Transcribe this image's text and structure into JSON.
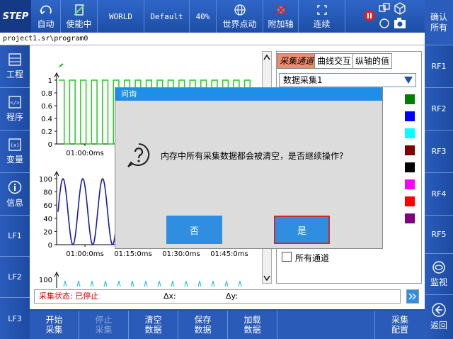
{
  "topbar": {
    "step": "STEP",
    "auto": "自动",
    "enable": "使能中",
    "world": "WORLD",
    "default": "Default",
    "speed": "40%",
    "world_jog": "世界点动",
    "aux_axis": "附加轴",
    "continuous": "连续"
  },
  "path": "project1.sr\\program0",
  "left_nav": [
    {
      "label": "工程"
    },
    {
      "label": "程序"
    },
    {
      "label": "变量"
    },
    {
      "label": "信息"
    },
    {
      "label": "LF1"
    },
    {
      "label": "LF2"
    },
    {
      "label": "LF3"
    }
  ],
  "right_nav": {
    "confirm_all": "确认\n所有",
    "rf": [
      "RF1",
      "RF2",
      "RF3",
      "RF4",
      "RF5"
    ],
    "monitor": "监视",
    "back": "返回"
  },
  "chart": {
    "top_yticks": [
      "1",
      "0.8",
      "0.6",
      "0.4",
      "0.2",
      "0"
    ],
    "top_xtick": "01:00:0ms",
    "mid_yticks": [
      "100",
      "80",
      "60",
      "40",
      "20",
      "0"
    ],
    "mid_xticks": [
      "01:00:0ms",
      "01:15:0ms",
      "01:30:0ms",
      "01:45:0ms"
    ],
    "bottom_ytick": "100"
  },
  "chart_data": [
    {
      "type": "line",
      "series": [
        {
          "values": [
            1,
            0,
            1,
            0,
            1,
            0,
            1,
            0,
            1,
            0,
            1,
            0,
            1,
            0,
            1,
            0,
            1,
            0,
            1,
            0,
            1,
            0,
            1,
            0,
            1,
            0,
            1,
            0,
            1,
            0,
            1,
            0,
            1,
            0,
            1,
            0
          ]
        }
      ],
      "ylim": [
        0,
        1
      ],
      "color": "#22cc22"
    },
    {
      "type": "line",
      "series": [
        {
          "values": [
            50,
            100,
            50,
            0,
            50,
            100,
            50,
            0,
            50,
            100,
            50,
            0
          ]
        }
      ],
      "ylim": [
        0,
        100
      ],
      "color": "#1a1aa8"
    }
  ],
  "panel": {
    "tabs": [
      "采集通道",
      "曲线交互",
      "纵轴的值"
    ],
    "select_value": "数据采集1",
    "legend_colors": [
      "#008000",
      "#0000ff",
      "#00ffff",
      "#800000",
      "#000000",
      "#ff00ff",
      "#ff0000",
      "#800080"
    ],
    "all_channels": "所有通道"
  },
  "status": {
    "label": "采集状态: 已停止",
    "dx": "Δx:",
    "dy": "Δy:"
  },
  "bottom": {
    "start": "开始\n采集",
    "stop": "停止\n采集",
    "clear": "清空\n数据",
    "save": "保存\n数据",
    "load": "加载\n数据",
    "config": "采集\n配置"
  },
  "dialog": {
    "title": "问询",
    "message": "内存中所有采集数据都会被清空，是否继续操作?",
    "no": "否",
    "yes": "是"
  }
}
